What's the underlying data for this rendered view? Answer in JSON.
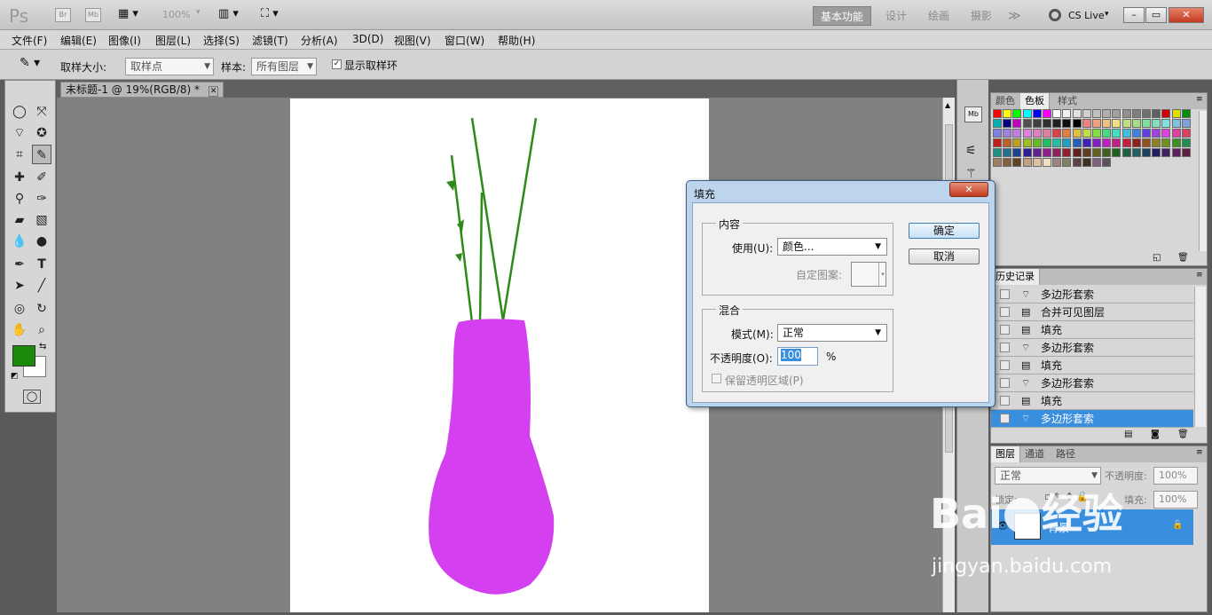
{
  "app": {
    "logo": "Ps",
    "icon_br": "Br",
    "icon_mb": "Mb",
    "zoom": "100%"
  },
  "workspaces": [
    "基本功能",
    "设计",
    "绘画",
    "摄影"
  ],
  "more_label": "≫",
  "cs_live": "CS Live",
  "window_buttons": {
    "min": "–",
    "max": "▭",
    "close": "✕"
  },
  "menu": [
    "文件(F)",
    "编辑(E)",
    "图像(I)",
    "图层(L)",
    "选择(S)",
    "滤镜(T)",
    "分析(A)",
    "3D(D)",
    "视图(V)",
    "窗口(W)",
    "帮助(H)"
  ],
  "options": {
    "sample_size_label": "取样大小:",
    "sample_size_value": "取样点",
    "sample_label": "样本:",
    "sample_value": "所有图层",
    "show_ring_label": "显示取样环"
  },
  "document": {
    "tab_title": "未标题-1 @ 19%(RGB/8) *",
    "close": "✕"
  },
  "colors": {
    "foreground": "#1a8a0a",
    "background": "#ffffff",
    "vase": "#d43ff0",
    "stem": "#2e8b1a",
    "accent": "#3a8ede"
  },
  "swatches_panel": {
    "tabs": [
      "颜色",
      "色板",
      "样式"
    ],
    "active_tab": "色板",
    "swatch_colors": [
      "#ff0000",
      "#ffff00",
      "#00ff00",
      "#00ffff",
      "#0000ff",
      "#ff00ff",
      "#ffffff",
      "#f0f0f0",
      "#e0e0e0",
      "#d0d0d0",
      "#c0c0c0",
      "#b0b0b0",
      "#a0a0a0",
      "#909090",
      "#808080",
      "#707070",
      "#606060",
      "#d00000",
      "#e0e000",
      "#009000",
      "#00b0b0",
      "#000080",
      "#c000c0",
      "#505050",
      "#404040",
      "#303030",
      "#202020",
      "#101010",
      "#000000",
      "#f08080",
      "#f0a080",
      "#f0c080",
      "#f0e080",
      "#c0e080",
      "#a0e080",
      "#80e0a0",
      "#80e0c0",
      "#80e0e0",
      "#80c0e0",
      "#80a0e0",
      "#8080e0",
      "#a080e0",
      "#c080e0",
      "#e080e0",
      "#e080c0",
      "#e080a0",
      "#e04040",
      "#e08040",
      "#e0c040",
      "#c0e040",
      "#80e040",
      "#40e080",
      "#40e0c0",
      "#40c0e0",
      "#4080e0",
      "#6040e0",
      "#a040e0",
      "#e040e0",
      "#e040a0",
      "#e04060",
      "#c02020",
      "#c06020",
      "#c0a020",
      "#a0c020",
      "#60c020",
      "#20c060",
      "#20c0a0",
      "#20a0c0",
      "#2060c0",
      "#4020c0",
      "#8020c0",
      "#c020c0",
      "#c02080",
      "#c02040",
      "#902020",
      "#905020",
      "#908020",
      "#709020",
      "#409020",
      "#209050",
      "#209080",
      "#207090",
      "#204090",
      "#302090",
      "#602090",
      "#902090",
      "#902060",
      "#902030",
      "#602020",
      "#604020",
      "#606020",
      "#406020",
      "#206020",
      "#206040",
      "#206060",
      "#204060",
      "#202060",
      "#402060",
      "#602060",
      "#602040",
      "#a08060",
      "#806040",
      "#604020",
      "#c0a080",
      "#e0c0a0",
      "#f0e0c0",
      "#a08080",
      "#808060",
      "#604040",
      "#403020",
      "#806080",
      "#605060"
    ],
    "footer_icons": [
      "new-swatch-icon",
      "trash-icon"
    ]
  },
  "history_panel": {
    "tab": "历史记录",
    "items": [
      {
        "label": "多边形套索",
        "icon": "lasso"
      },
      {
        "label": "合并可见图层",
        "icon": "doc"
      },
      {
        "label": "填充",
        "icon": "doc"
      },
      {
        "label": "多边形套索",
        "icon": "lasso"
      },
      {
        "label": "填充",
        "icon": "doc"
      },
      {
        "label": "多边形套索",
        "icon": "lasso"
      },
      {
        "label": "填充",
        "icon": "doc"
      },
      {
        "label": "多边形套索",
        "icon": "lasso",
        "selected": true
      }
    ]
  },
  "layers_panel": {
    "tabs": [
      "图层",
      "通道",
      "路径"
    ],
    "blend_mode": "正常",
    "opacity_label": "不透明度:",
    "opacity_value": "100%",
    "lock_label": "锁定:",
    "fill_label": "填充:",
    "fill_value": "100%",
    "layer_name": "背景"
  },
  "dialog": {
    "title": "填充",
    "close": "✕",
    "content_group": "内容",
    "use_label": "使用(U):",
    "use_value": "颜色...",
    "custom_pattern_label": "自定图案:",
    "blend_group": "混合",
    "mode_label": "模式(M):",
    "mode_value": "正常",
    "opacity_label": "不透明度(O):",
    "opacity_value": "100",
    "percent": "%",
    "preserve_label": "保留透明区域(P)",
    "ok": "确定",
    "cancel": "取消"
  },
  "watermark": {
    "brand": "Bai",
    "brand2": "经验",
    "url": "jingyan.baidu.com"
  }
}
